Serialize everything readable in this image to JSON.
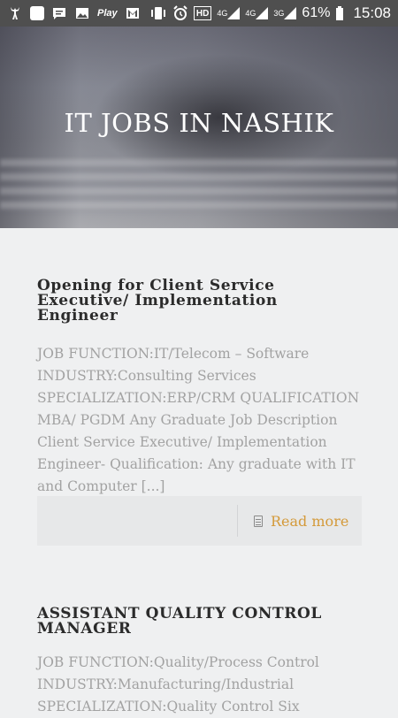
{
  "status_bar": {
    "play_label": "Play",
    "network_4g_a": "4G",
    "network_4g_b": "4G",
    "network_3g": "3G",
    "hd_label": "HD",
    "battery_percent": "61%",
    "time": "15:08",
    "icons": [
      "deer-icon",
      "square-app-icon",
      "message-icon",
      "image-icon",
      "play-icon",
      "gmail-icon",
      "vibrate-icon",
      "alarm-icon",
      "hd-icon",
      "signal-icon",
      "signal-icon",
      "signal-icon",
      "battery-icon"
    ]
  },
  "hero": {
    "title": "IT JOBS IN NASHIK"
  },
  "posts": [
    {
      "title": "Opening for Client Service Executive/ Implementation Engineer",
      "excerpt": "JOB FUNCTION:IT/Telecom – Software INDUSTRY:Consulting Services SPECIALIZATION:ERP/CRM QUALIFICATION MBA/ PGDM Any Graduate Job Description Client Service Executive/ Implementation Engineer- Qualification: Any graduate with IT and Computer [...]",
      "read_more": "Read more"
    },
    {
      "title": "ASSISTANT QUALITY CONTROL MANAGER",
      "excerpt": "JOB FUNCTION:Quality/Process Control INDUSTRY:Manufacturing/Industrial SPECIALIZATION:Quality Control Six"
    }
  ],
  "colors": {
    "status_bar_bg": "#4f4f4f",
    "page_bg": "#eff0f1",
    "accent_read_more": "#d49a3a",
    "excerpt_text": "#a2a2a2"
  }
}
